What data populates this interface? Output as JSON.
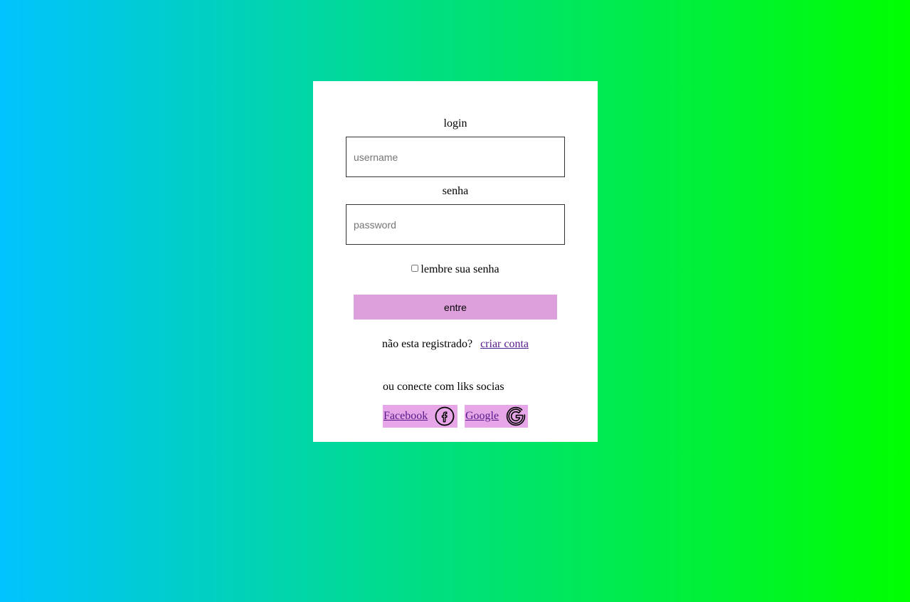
{
  "form": {
    "login_label": "login",
    "username_placeholder": "username",
    "password_label": "senha",
    "password_placeholder": "password",
    "remember_label": "lembre sua senha",
    "submit_label": "entre",
    "register_prompt": "não esta registrado?",
    "register_link": "criar conta"
  },
  "social": {
    "title": "ou conecte com liks socias",
    "facebook_label": "Facebook",
    "facebook_icon": "facebook-icon",
    "google_label": "Google",
    "google_icon": "google-icon",
    "button_color": "#e7a6e7"
  },
  "colors": {
    "gradient_start": "#00c3ff",
    "gradient_end": "#00ff00",
    "submit_button": "#dda0dd",
    "link": "#551a8b"
  }
}
